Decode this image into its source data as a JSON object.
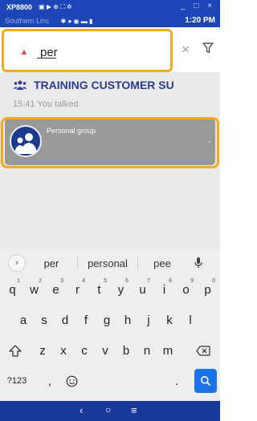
{
  "window": {
    "title": "XP8800",
    "controls": "_ □ ×"
  },
  "status": {
    "carrier": "Southern Linc",
    "time": "1:20 PM"
  },
  "search": {
    "query": "per"
  },
  "results": {
    "chat": {
      "title": "TRAINING CUSTOMER SU",
      "subtitle": "15:41 You talked"
    },
    "group": {
      "name": "Personal group"
    }
  },
  "keyboard": {
    "suggestions": [
      "per",
      "personal",
      "pee"
    ],
    "rows": [
      {
        "keys": [
          "q",
          "w",
          "e",
          "r",
          "t",
          "y",
          "u",
          "i",
          "o",
          "p"
        ],
        "hints": [
          "1",
          "2",
          "3",
          "4",
          "5",
          "6",
          "7",
          "8",
          "9",
          "0"
        ]
      },
      {
        "keys": [
          "a",
          "s",
          "d",
          "f",
          "g",
          "h",
          "j",
          "k",
          "l"
        ]
      },
      {
        "keys": [
          "z",
          "x",
          "c",
          "v",
          "b",
          "n",
          "m"
        ]
      }
    ],
    "symbols_label": "?123",
    "comma_label": ",",
    "period_label": "."
  },
  "colors": {
    "header_blue": "#1e45b8",
    "highlight_orange": "#f5a91c",
    "title_blue": "#2a3c96",
    "enter_blue": "#1a73e8"
  },
  "icons": [
    "app-logo-icon",
    "clear-icon",
    "filter-icon",
    "group-people-icon",
    "group-avatar-icon",
    "keyboard-back-icon",
    "microphone-icon",
    "shift-icon",
    "backspace-icon",
    "emoji-icon",
    "search-enter-icon",
    "nav-back-icon",
    "nav-home-icon",
    "nav-recents-icon"
  ]
}
